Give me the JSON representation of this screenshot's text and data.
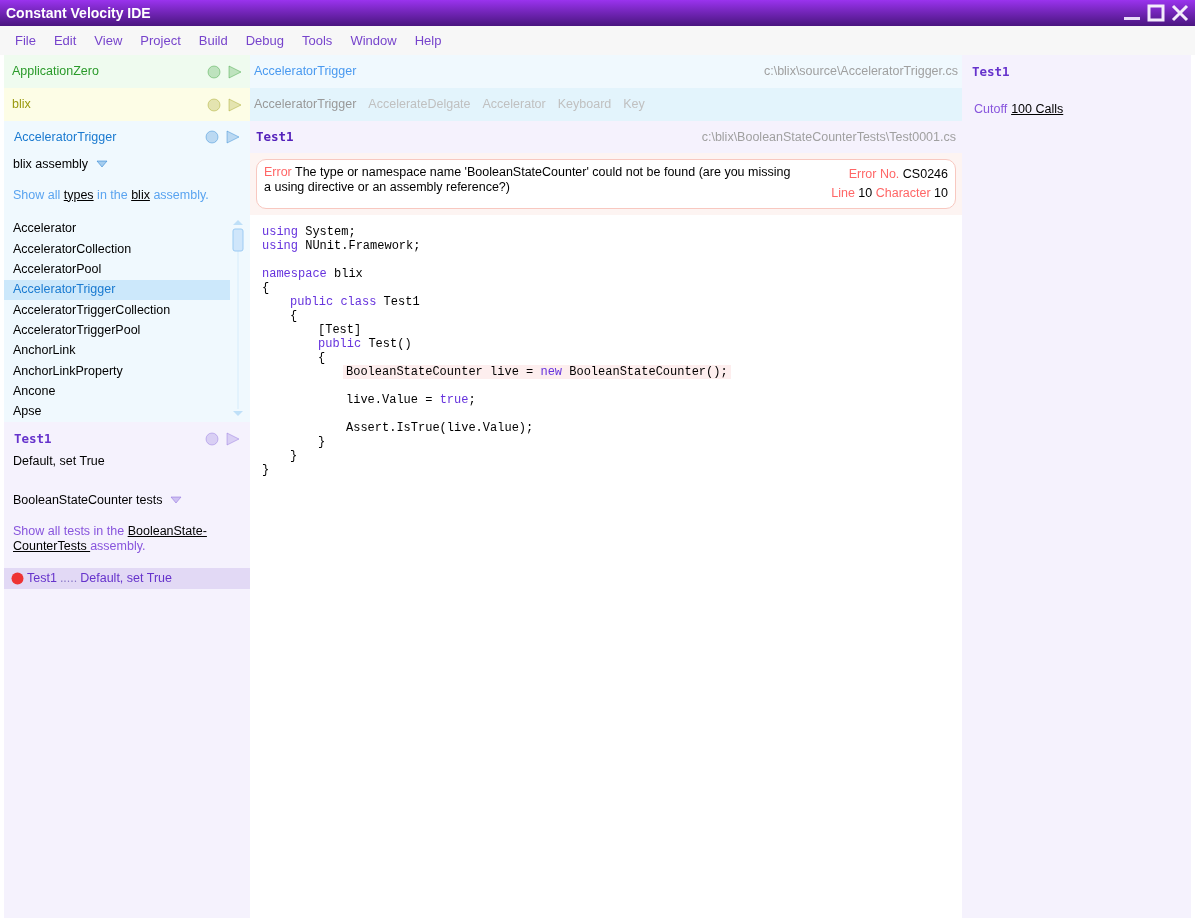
{
  "window": {
    "title": "Constant Velocity IDE"
  },
  "menu": [
    "File",
    "Edit",
    "View",
    "Project",
    "Build",
    "Debug",
    "Tools",
    "Window",
    "Help"
  ],
  "projects": [
    {
      "name": "ApplicationZero",
      "color": "#2a9a2a"
    },
    {
      "name": "blix",
      "color": "#9a9a10"
    }
  ],
  "type_browser": {
    "title": "AcceleratorTrigger",
    "color": "#1a7ad0",
    "assembly": "blix assembly",
    "show_all": [
      {
        "text": "Show all ",
        "link": false
      },
      {
        "text": "types",
        "link": true
      },
      {
        "text": " in the ",
        "link": false
      },
      {
        "text": "blix",
        "link": true
      },
      {
        "text": " assembly.",
        "link": false
      }
    ],
    "types": [
      {
        "name": "Accelerator",
        "selected": false
      },
      {
        "name": "AcceleratorCollection",
        "selected": false
      },
      {
        "name": "AcceleratorPool",
        "selected": false
      },
      {
        "name": "AcceleratorTrigger",
        "selected": true
      },
      {
        "name": "AcceleratorTriggerCollection",
        "selected": false
      },
      {
        "name": "AcceleratorTriggerPool",
        "selected": false
      },
      {
        "name": "AnchorLink",
        "selected": false
      },
      {
        "name": "AnchorLinkProperty",
        "selected": false
      },
      {
        "name": "Ancone",
        "selected": false
      },
      {
        "name": "Apse",
        "selected": false
      }
    ]
  },
  "test_browser": {
    "title": "Test1",
    "subtitle": "Default, set True",
    "group": "BooleanStateCounter tests",
    "show_all": [
      {
        "text": "Show all tests in the ",
        "link": false
      },
      {
        "text": "BooleanState-",
        "link": true
      },
      {
        "text": "CounterTests ",
        "link": true
      },
      {
        "text": "assembly.",
        "link": false
      }
    ],
    "tests": [
      {
        "name": "Test1",
        "dots": ".....",
        "description": "Default, set True",
        "color": "#ee3333",
        "selected": true
      }
    ]
  },
  "source_header": {
    "name": "AcceleratorTrigger",
    "path": "c:\\blix\\source\\AcceleratorTrigger.cs"
  },
  "breadcrumbs": [
    "AcceleratorTrigger",
    "AccelerateDelgate",
    "Accelerator",
    "Keyboard",
    "Key"
  ],
  "editor": {
    "title": "Test1",
    "path": "c:\\blix\\BooleanStateCounterTests\\Test0001.cs",
    "error": {
      "label": "Error",
      "message": "The type or namespace name 'BooleanStateCounter' could not be found (are you missing a using directive or an assembly reference?)",
      "number_label": "Error No.",
      "number": "CS0246",
      "line_label": "Line",
      "line": "10",
      "char_label": "Character",
      "char": "10"
    },
    "code": [
      {
        "kind": "code",
        "tokens": [
          {
            "kind": "keyword",
            "text": "using"
          },
          {
            "kind": "plain",
            "text": " System;"
          }
        ]
      },
      {
        "kind": "code",
        "tokens": [
          {
            "kind": "keyword",
            "text": "using"
          },
          {
            "kind": "plain",
            "text": " NUnit.Framework;"
          }
        ]
      },
      {
        "kind": "blank"
      },
      {
        "kind": "code",
        "tokens": [
          {
            "kind": "keyword",
            "text": "namespace"
          },
          {
            "kind": "plain",
            "text": " blix"
          }
        ]
      },
      {
        "kind": "code",
        "tokens": [
          {
            "kind": "plain",
            "text": "{"
          }
        ]
      },
      {
        "kind": "block",
        "children": [
          {
            "kind": "code",
            "tokens": [
              {
                "kind": "keyword",
                "text": "public class"
              },
              {
                "kind": "plain",
                "text": " Test1"
              }
            ]
          },
          {
            "kind": "code",
            "tokens": [
              {
                "kind": "plain",
                "text": "{"
              }
            ]
          },
          {
            "kind": "block",
            "children": [
              {
                "kind": "code",
                "tokens": [
                  {
                    "kind": "plain",
                    "text": "[Test]"
                  }
                ]
              },
              {
                "kind": "code",
                "tokens": [
                  {
                    "kind": "keyword",
                    "text": "public"
                  },
                  {
                    "kind": "plain",
                    "text": " Test()"
                  }
                ]
              },
              {
                "kind": "code",
                "tokens": [
                  {
                    "kind": "plain",
                    "text": "{"
                  }
                ]
              },
              {
                "kind": "block",
                "children": [
                  {
                    "kind": "error",
                    "tokens": [
                      {
                        "kind": "plain",
                        "text": "BooleanStateCounter live = "
                      },
                      {
                        "kind": "keyword",
                        "text": "new"
                      },
                      {
                        "kind": "plain",
                        "text": " BooleanStateCounter();"
                      }
                    ]
                  },
                  {
                    "kind": "blank"
                  },
                  {
                    "kind": "code",
                    "tokens": [
                      {
                        "kind": "plain",
                        "text": "live.Value = "
                      },
                      {
                        "kind": "keyword",
                        "text": "true"
                      },
                      {
                        "kind": "plain",
                        "text": ";"
                      }
                    ]
                  },
                  {
                    "kind": "blank"
                  },
                  {
                    "kind": "code",
                    "tokens": [
                      {
                        "kind": "plain",
                        "text": "Assert.IsTrue(live.Value);"
                      }
                    ]
                  }
                ]
              },
              {
                "kind": "code",
                "tokens": [
                  {
                    "kind": "plain",
                    "text": "}"
                  }
                ]
              }
            ]
          },
          {
            "kind": "code",
            "tokens": [
              {
                "kind": "plain",
                "text": "}"
              }
            ]
          }
        ]
      },
      {
        "kind": "code",
        "tokens": [
          {
            "kind": "plain",
            "text": "}"
          }
        ]
      }
    ]
  },
  "profiler": {
    "title": "Test1",
    "cutoff_label": "Cutoff",
    "cutoff_value": "100 Calls"
  }
}
